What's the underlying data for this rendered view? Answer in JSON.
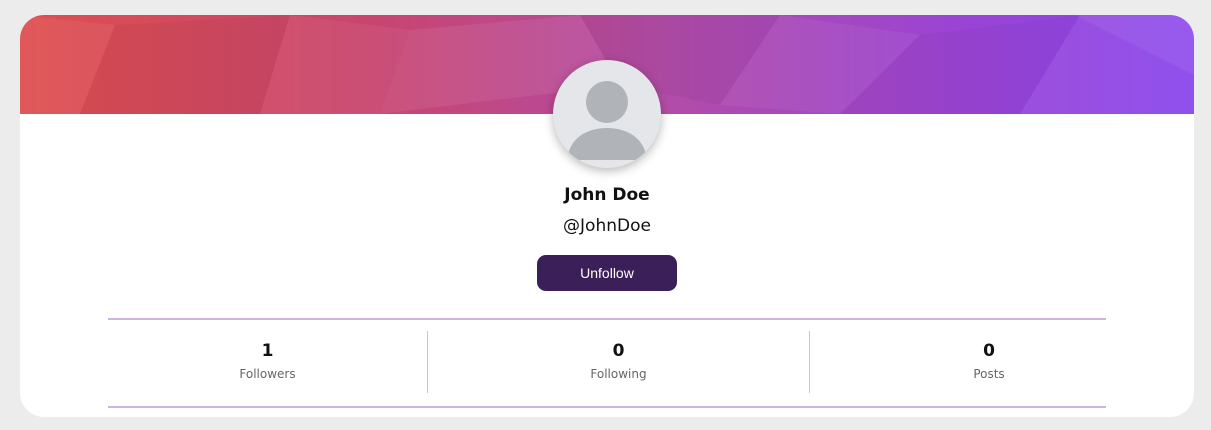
{
  "profile": {
    "name": "John Doe",
    "handle": "@JohnDoe",
    "follow_button_label": "Unfollow",
    "avatar_icon": "default-user-avatar-icon"
  },
  "stats": [
    {
      "value": "1",
      "label": "Followers"
    },
    {
      "value": "0",
      "label": "Following"
    },
    {
      "value": "0",
      "label": "Posts"
    }
  ],
  "colors": {
    "page_background": "#ececec",
    "banner_gradient_start": "#df4e4e",
    "banner_gradient_end": "#8a46ec",
    "button_background": "#3b1f58",
    "rule_color": "#cfb2e0"
  }
}
